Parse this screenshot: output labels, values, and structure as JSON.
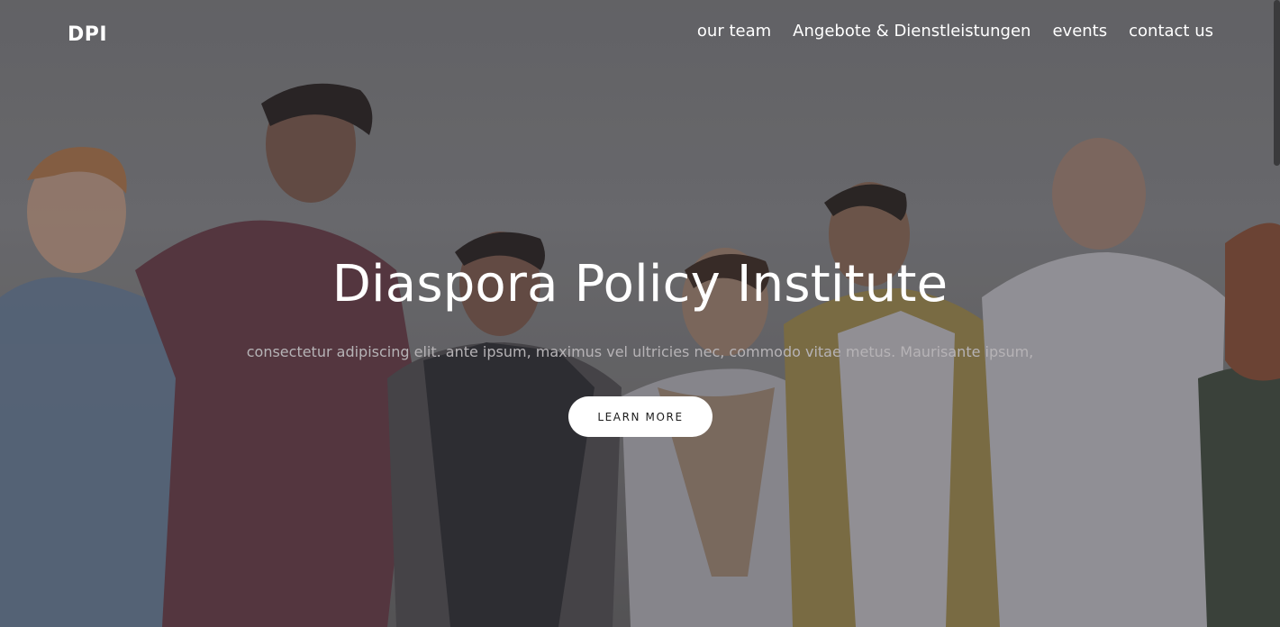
{
  "nav": {
    "logo": "DPI",
    "links": [
      {
        "label": "our team"
      },
      {
        "label": "Angebote & Dienstleistungen"
      },
      {
        "label": "events"
      },
      {
        "label": "contact us"
      }
    ]
  },
  "hero": {
    "title": "Diaspora Policy Institute",
    "subtitle": "consectetur adipiscing elit. ante ipsum, maximus vel ultricies nec, commodo vitae metus. Maurisante ipsum,",
    "cta_label": "LEARN MORE"
  },
  "colors": {
    "overlay": "#6f6f72",
    "text": "#ffffff",
    "button_bg": "#ffffff",
    "button_text": "#1c1c1c"
  }
}
